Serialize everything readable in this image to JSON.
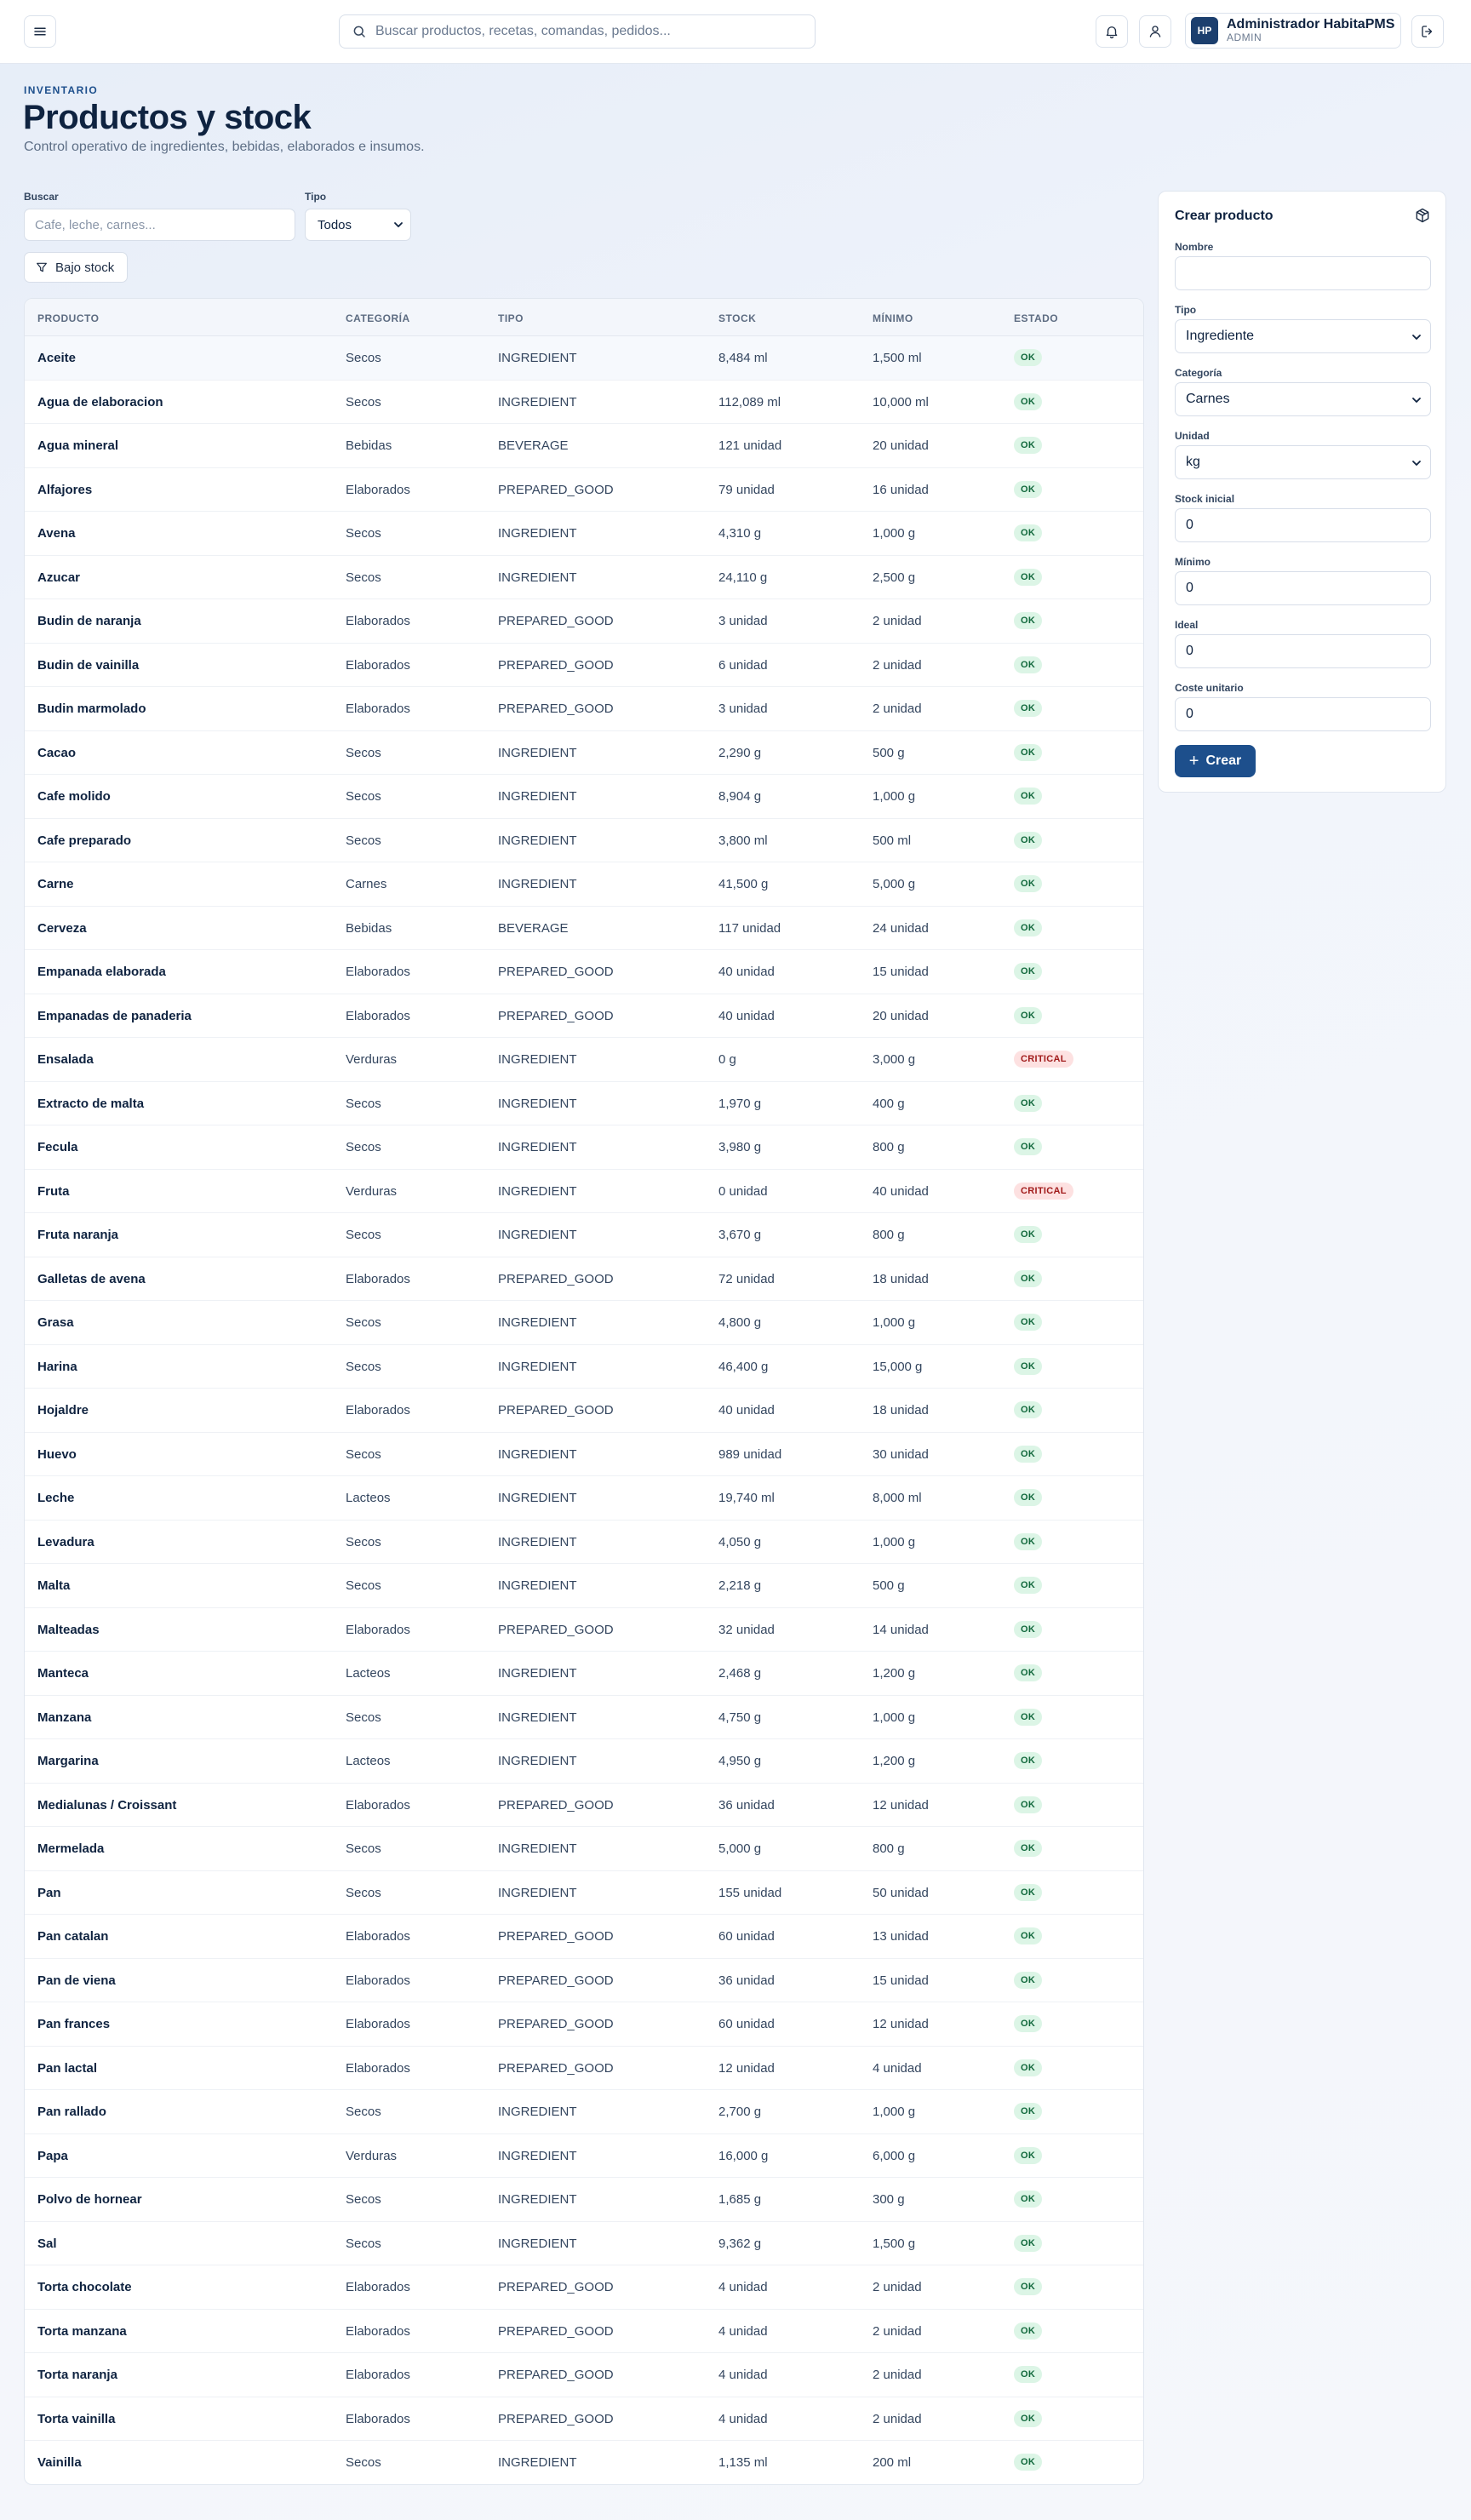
{
  "topbar": {
    "search_placeholder": "Buscar productos, recetas, comandas, pedidos...",
    "user_initials": "HP",
    "user_name": "Administrador HabitaPMS",
    "user_role": "ADMIN"
  },
  "header": {
    "eyebrow": "INVENTARIO",
    "title": "Productos y stock",
    "subtitle": "Control operativo de ingredientes, bebidas, elaborados e insumos."
  },
  "filters": {
    "search_label": "Buscar",
    "search_placeholder": "Cafe, leche, carnes...",
    "type_label": "Tipo",
    "type_value": "Todos",
    "low_stock_label": "Bajo stock"
  },
  "table": {
    "columns": [
      "PRODUCTO",
      "CATEGORÍA",
      "TIPO",
      "STOCK",
      "MÍNIMO",
      "ESTADO"
    ],
    "rows": [
      [
        "Aceite",
        "Secos",
        "INGREDIENT",
        "8,484 ml",
        "1,500 ml",
        "OK"
      ],
      [
        "Agua de elaboracion",
        "Secos",
        "INGREDIENT",
        "112,089 ml",
        "10,000 ml",
        "OK"
      ],
      [
        "Agua mineral",
        "Bebidas",
        "BEVERAGE",
        "121 unidad",
        "20 unidad",
        "OK"
      ],
      [
        "Alfajores",
        "Elaborados",
        "PREPARED_GOOD",
        "79 unidad",
        "16 unidad",
        "OK"
      ],
      [
        "Avena",
        "Secos",
        "INGREDIENT",
        "4,310 g",
        "1,000 g",
        "OK"
      ],
      [
        "Azucar",
        "Secos",
        "INGREDIENT",
        "24,110 g",
        "2,500 g",
        "OK"
      ],
      [
        "Budin de naranja",
        "Elaborados",
        "PREPARED_GOOD",
        "3 unidad",
        "2 unidad",
        "OK"
      ],
      [
        "Budin de vainilla",
        "Elaborados",
        "PREPARED_GOOD",
        "6 unidad",
        "2 unidad",
        "OK"
      ],
      [
        "Budin marmolado",
        "Elaborados",
        "PREPARED_GOOD",
        "3 unidad",
        "2 unidad",
        "OK"
      ],
      [
        "Cacao",
        "Secos",
        "INGREDIENT",
        "2,290 g",
        "500 g",
        "OK"
      ],
      [
        "Cafe molido",
        "Secos",
        "INGREDIENT",
        "8,904 g",
        "1,000 g",
        "OK"
      ],
      [
        "Cafe preparado",
        "Secos",
        "INGREDIENT",
        "3,800 ml",
        "500 ml",
        "OK"
      ],
      [
        "Carne",
        "Carnes",
        "INGREDIENT",
        "41,500 g",
        "5,000 g",
        "OK"
      ],
      [
        "Cerveza",
        "Bebidas",
        "BEVERAGE",
        "117 unidad",
        "24 unidad",
        "OK"
      ],
      [
        "Empanada elaborada",
        "Elaborados",
        "PREPARED_GOOD",
        "40 unidad",
        "15 unidad",
        "OK"
      ],
      [
        "Empanadas de panaderia",
        "Elaborados",
        "PREPARED_GOOD",
        "40 unidad",
        "20 unidad",
        "OK"
      ],
      [
        "Ensalada",
        "Verduras",
        "INGREDIENT",
        "0 g",
        "3,000 g",
        "CRITICAL"
      ],
      [
        "Extracto de malta",
        "Secos",
        "INGREDIENT",
        "1,970 g",
        "400 g",
        "OK"
      ],
      [
        "Fecula",
        "Secos",
        "INGREDIENT",
        "3,980 g",
        "800 g",
        "OK"
      ],
      [
        "Fruta",
        "Verduras",
        "INGREDIENT",
        "0 unidad",
        "40 unidad",
        "CRITICAL"
      ],
      [
        "Fruta naranja",
        "Secos",
        "INGREDIENT",
        "3,670 g",
        "800 g",
        "OK"
      ],
      [
        "Galletas de avena",
        "Elaborados",
        "PREPARED_GOOD",
        "72 unidad",
        "18 unidad",
        "OK"
      ],
      [
        "Grasa",
        "Secos",
        "INGREDIENT",
        "4,800 g",
        "1,000 g",
        "OK"
      ],
      [
        "Harina",
        "Secos",
        "INGREDIENT",
        "46,400 g",
        "15,000 g",
        "OK"
      ],
      [
        "Hojaldre",
        "Elaborados",
        "PREPARED_GOOD",
        "40 unidad",
        "18 unidad",
        "OK"
      ],
      [
        "Huevo",
        "Secos",
        "INGREDIENT",
        "989 unidad",
        "30 unidad",
        "OK"
      ],
      [
        "Leche",
        "Lacteos",
        "INGREDIENT",
        "19,740 ml",
        "8,000 ml",
        "OK"
      ],
      [
        "Levadura",
        "Secos",
        "INGREDIENT",
        "4,050 g",
        "1,000 g",
        "OK"
      ],
      [
        "Malta",
        "Secos",
        "INGREDIENT",
        "2,218 g",
        "500 g",
        "OK"
      ],
      [
        "Malteadas",
        "Elaborados",
        "PREPARED_GOOD",
        "32 unidad",
        "14 unidad",
        "OK"
      ],
      [
        "Manteca",
        "Lacteos",
        "INGREDIENT",
        "2,468 g",
        "1,200 g",
        "OK"
      ],
      [
        "Manzana",
        "Secos",
        "INGREDIENT",
        "4,750 g",
        "1,000 g",
        "OK"
      ],
      [
        "Margarina",
        "Lacteos",
        "INGREDIENT",
        "4,950 g",
        "1,200 g",
        "OK"
      ],
      [
        "Medialunas / Croissant",
        "Elaborados",
        "PREPARED_GOOD",
        "36 unidad",
        "12 unidad",
        "OK"
      ],
      [
        "Mermelada",
        "Secos",
        "INGREDIENT",
        "5,000 g",
        "800 g",
        "OK"
      ],
      [
        "Pan",
        "Secos",
        "INGREDIENT",
        "155 unidad",
        "50 unidad",
        "OK"
      ],
      [
        "Pan catalan",
        "Elaborados",
        "PREPARED_GOOD",
        "60 unidad",
        "13 unidad",
        "OK"
      ],
      [
        "Pan de viena",
        "Elaborados",
        "PREPARED_GOOD",
        "36 unidad",
        "15 unidad",
        "OK"
      ],
      [
        "Pan frances",
        "Elaborados",
        "PREPARED_GOOD",
        "60 unidad",
        "12 unidad",
        "OK"
      ],
      [
        "Pan lactal",
        "Elaborados",
        "PREPARED_GOOD",
        "12 unidad",
        "4 unidad",
        "OK"
      ],
      [
        "Pan rallado",
        "Secos",
        "INGREDIENT",
        "2,700 g",
        "1,000 g",
        "OK"
      ],
      [
        "Papa",
        "Verduras",
        "INGREDIENT",
        "16,000 g",
        "6,000 g",
        "OK"
      ],
      [
        "Polvo de hornear",
        "Secos",
        "INGREDIENT",
        "1,685 g",
        "300 g",
        "OK"
      ],
      [
        "Sal",
        "Secos",
        "INGREDIENT",
        "9,362 g",
        "1,500 g",
        "OK"
      ],
      [
        "Torta chocolate",
        "Elaborados",
        "PREPARED_GOOD",
        "4 unidad",
        "2 unidad",
        "OK"
      ],
      [
        "Torta manzana",
        "Elaborados",
        "PREPARED_GOOD",
        "4 unidad",
        "2 unidad",
        "OK"
      ],
      [
        "Torta naranja",
        "Elaborados",
        "PREPARED_GOOD",
        "4 unidad",
        "2 unidad",
        "OK"
      ],
      [
        "Torta vainilla",
        "Elaborados",
        "PREPARED_GOOD",
        "4 unidad",
        "2 unidad",
        "OK"
      ],
      [
        "Vainilla",
        "Secos",
        "INGREDIENT",
        "1,135 ml",
        "200 ml",
        "OK"
      ]
    ]
  },
  "create": {
    "title": "Crear producto",
    "name_label": "Nombre",
    "name_value": "",
    "type_label": "Tipo",
    "type_value": "Ingrediente",
    "category_label": "Categoría",
    "category_value": "Carnes",
    "unit_label": "Unidad",
    "unit_value": "kg",
    "stock_label": "Stock inicial",
    "stock_value": "0",
    "min_label": "Mínimo",
    "min_value": "0",
    "ideal_label": "Ideal",
    "ideal_value": "0",
    "cost_label": "Coste unitario",
    "cost_value": "0",
    "submit_label": "Crear"
  },
  "colors": {
    "brand": "#1d4f8c",
    "navy": "#0f2340",
    "ok_bg": "#dcf5e6",
    "ok_text": "#11683c",
    "critical_bg": "#fde1e1",
    "critical_text": "#a11b1b"
  },
  "icons": [
    "menu-icon",
    "search-icon",
    "bell-icon",
    "user-icon",
    "logout-icon",
    "filter-icon",
    "package-icon",
    "plus-icon",
    "chevron-down-icon"
  ]
}
